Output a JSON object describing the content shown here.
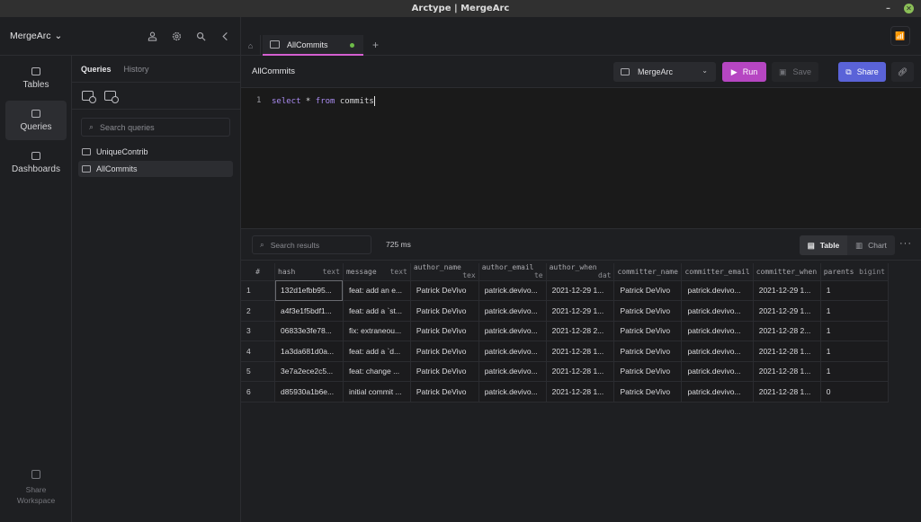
{
  "window": {
    "title": "Arctype | MergeArc",
    "minimize": "–",
    "close": "✕"
  },
  "workspace": {
    "name": "MergeArc",
    "icons": [
      "user-icon",
      "gear-icon",
      "search-icon",
      "chevron-left-icon"
    ]
  },
  "nav": {
    "items": [
      {
        "label": "Tables",
        "icon": "table-icon",
        "active": false
      },
      {
        "label": "Queries",
        "icon": "terminal-icon",
        "active": true
      },
      {
        "label": "Dashboards",
        "icon": "dashboard-icon",
        "active": false
      }
    ],
    "share_workspace": "Share Workspace"
  },
  "query_panel": {
    "tabs": [
      {
        "label": "Queries",
        "active": true
      },
      {
        "label": "History",
        "active": false
      }
    ],
    "search_placeholder": "Search queries",
    "items": [
      {
        "label": "UniqueContrib",
        "active": false
      },
      {
        "label": "AllCommits",
        "active": true
      }
    ]
  },
  "tabs": {
    "open": [
      {
        "label": "AllCommits",
        "status": "unsaved-dot",
        "status_color": "#6dbb48"
      }
    ],
    "add": "+"
  },
  "query": {
    "title": "AllCommits",
    "database": "MergeArc",
    "run_label": "Run",
    "save_label": "Save",
    "share_label": "Share",
    "editor": {
      "line": "1",
      "keyword1": "select",
      "rest1": " * ",
      "keyword2": "from",
      "rest2": " commits"
    }
  },
  "colors": {
    "run": "#b646c2",
    "share": "#5a63d8",
    "tab_accent": "#d45fd0",
    "keyword": "#a98bf0"
  },
  "results": {
    "search_placeholder": "Search results",
    "timing": "725 ms",
    "views": [
      {
        "label": "Table",
        "active": true
      },
      {
        "label": "Chart",
        "active": false
      }
    ],
    "more": "···",
    "columns": [
      {
        "name": "#",
        "type": ""
      },
      {
        "name": "hash",
        "type": "text"
      },
      {
        "name": "message",
        "type": "text"
      },
      {
        "name": "author_name",
        "type": "tex"
      },
      {
        "name": "author_email",
        "type": "te"
      },
      {
        "name": "author_when",
        "type": "dat"
      },
      {
        "name": "committer_name",
        "type": ""
      },
      {
        "name": "committer_email",
        "type": ""
      },
      {
        "name": "committer_when",
        "type": ""
      },
      {
        "name": "parents",
        "type": "bigint"
      }
    ],
    "rows": [
      [
        "1",
        "132d1efbb95...",
        "feat: add an e...",
        "Patrick DeVivo",
        "patrick.devivo...",
        "2021-12-29 1...",
        "Patrick DeVivo",
        "patrick.devivo...",
        "2021-12-29 1...",
        "1"
      ],
      [
        "2",
        "a4f3e1f5bdf1...",
        "feat: add a `st...",
        "Patrick DeVivo",
        "patrick.devivo...",
        "2021-12-29 1...",
        "Patrick DeVivo",
        "patrick.devivo...",
        "2021-12-29 1...",
        "1"
      ],
      [
        "3",
        "06833e3fe78...",
        "fix: extraneou...",
        "Patrick DeVivo",
        "patrick.devivo...",
        "2021-12-28 2...",
        "Patrick DeVivo",
        "patrick.devivo...",
        "2021-12-28 2...",
        "1"
      ],
      [
        "4",
        "1a3da681d0a...",
        "feat: add a `d...",
        "Patrick DeVivo",
        "patrick.devivo...",
        "2021-12-28 1...",
        "Patrick DeVivo",
        "patrick.devivo...",
        "2021-12-28 1...",
        "1"
      ],
      [
        "5",
        "3e7a2ece2c5...",
        "feat: change ...",
        "Patrick DeVivo",
        "patrick.devivo...",
        "2021-12-28 1...",
        "Patrick DeVivo",
        "patrick.devivo...",
        "2021-12-28 1...",
        "1"
      ],
      [
        "6",
        "d85930a1b6e...",
        "initial commit ...",
        "Patrick DeVivo",
        "patrick.devivo...",
        "2021-12-28 1...",
        "Patrick DeVivo",
        "patrick.devivo...",
        "2021-12-28 1...",
        "0"
      ]
    ]
  }
}
